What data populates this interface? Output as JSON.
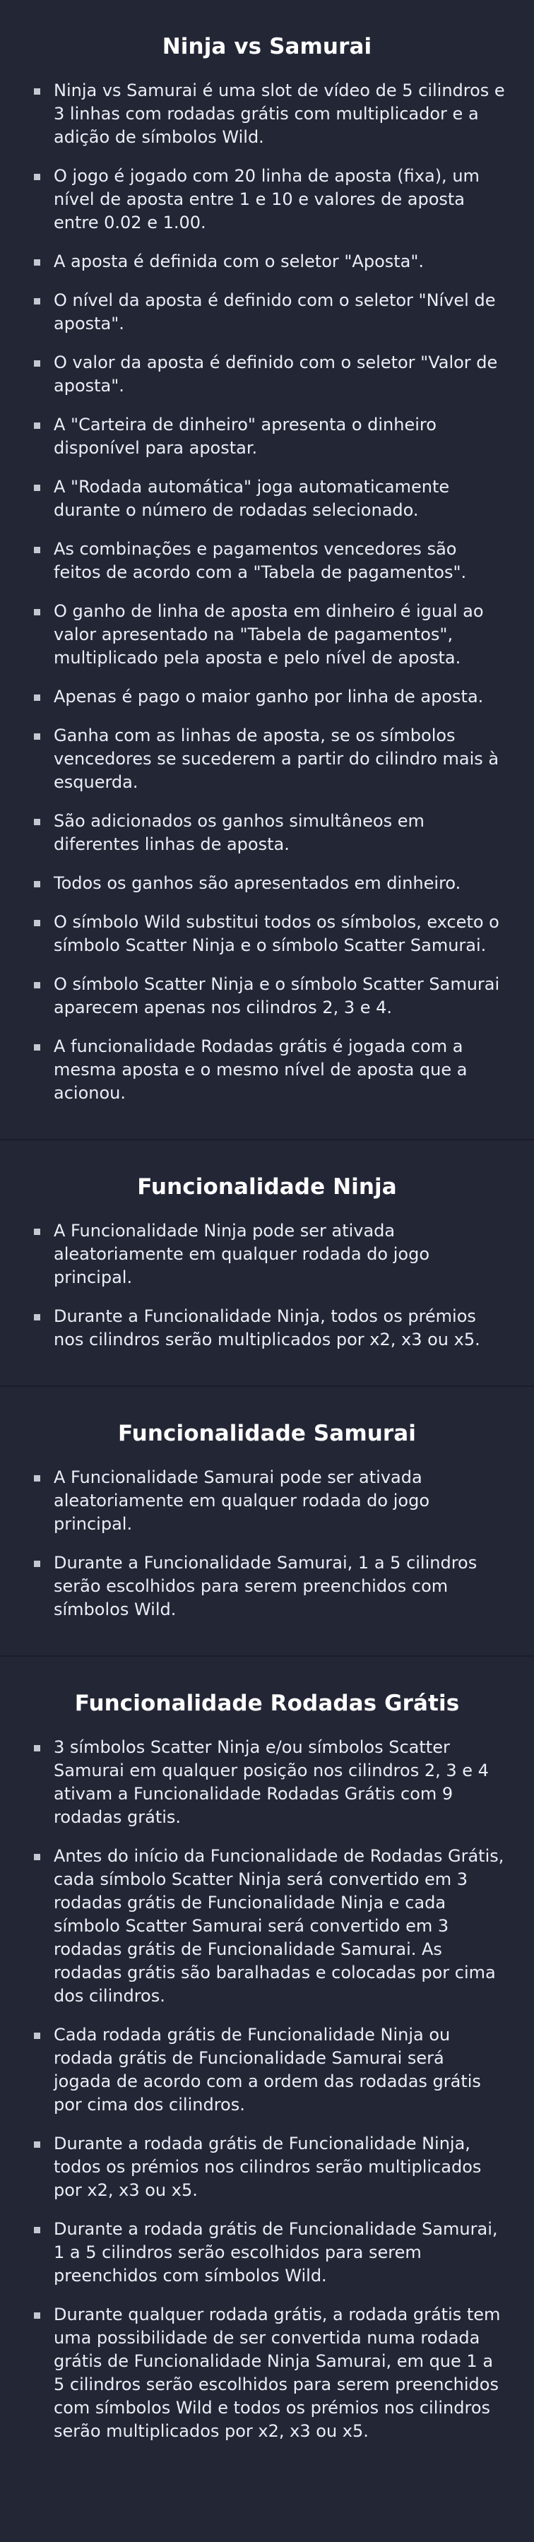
{
  "sections": [
    {
      "title": "Ninja vs Samurai",
      "items": [
        "Ninja vs Samurai é uma slot de vídeo de 5 cilindros e 3 linhas com rodadas grátis com multiplicador e a adição de símbolos Wild.",
        "O jogo é jogado com 20 linha de aposta (fixa), um nível de aposta entre 1 e 10 e valores de aposta entre 0.02 e 1.00.",
        "A aposta é definida com o seletor \"Aposta\".",
        "O nível da aposta é definido com o seletor \"Nível de aposta\".",
        "O valor da aposta é definido com o seletor \"Valor de aposta\".",
        "A \"Carteira de dinheiro\" apresenta o dinheiro disponível para apostar.",
        "A \"Rodada automática\" joga automaticamente durante o número de rodadas selecionado.",
        "As combinações e pagamentos vencedores são feitos de acordo com a \"Tabela de pagamentos\".",
        "O ganho de linha de aposta em dinheiro é igual ao valor apresentado na \"Tabela de pagamentos\", multiplicado pela aposta e pelo nível de aposta.",
        "Apenas é pago o maior ganho por linha de aposta.",
        "Ganha com as linhas de aposta, se os símbolos vencedores se sucederem a partir do cilindro mais à esquerda.",
        "São adicionados os ganhos simultâneos em diferentes linhas de aposta.",
        "Todos os ganhos são apresentados em dinheiro.",
        "O símbolo Wild substitui todos os símbolos, exceto o símbolo Scatter Ninja e o símbolo Scatter Samurai.",
        "O símbolo Scatter Ninja e o símbolo Scatter Samurai aparecem apenas nos cilindros 2, 3 e 4.",
        "A funcionalidade Rodadas grátis é jogada com a mesma aposta e o mesmo nível de aposta que a acionou."
      ]
    },
    {
      "title": "Funcionalidade Ninja",
      "items": [
        "A Funcionalidade Ninja pode ser ativada aleatoriamente em qualquer rodada do jogo principal.",
        "Durante a Funcionalidade Ninja, todos os prémios nos cilindros serão multiplicados por x2, x3 ou x5."
      ]
    },
    {
      "title": "Funcionalidade Samurai",
      "items": [
        "A Funcionalidade Samurai pode ser ativada aleatoriamente em qualquer rodada do jogo principal.",
        "Durante a Funcionalidade Samurai, 1 a 5 cilindros serão escolhidos para serem preenchidos com símbolos Wild."
      ]
    },
    {
      "title": "Funcionalidade Rodadas Grátis",
      "items": [
        "3 símbolos Scatter Ninja e/ou símbolos Scatter Samurai em qualquer posição nos cilindros 2, 3 e 4 ativam a Funcionalidade Rodadas Grátis com 9 rodadas grátis.",
        "Antes do início da Funcionalidade de Rodadas Grátis, cada símbolo Scatter Ninja será convertido em 3 rodadas grátis de Funcionalidade Ninja e cada símbolo Scatter Samurai será convertido em 3 rodadas grátis de Funcionalidade Samurai. As rodadas grátis são baralhadas e colocadas por cima dos cilindros.",
        "Cada rodada grátis de Funcionalidade Ninja ou rodada grátis de Funcionalidade Samurai será jogada de acordo com a ordem das rodadas grátis por cima dos cilindros.",
        "Durante a rodada grátis de Funcionalidade Ninja, todos os prémios nos cilindros serão multiplicados por x2, x3 ou x5.",
        "Durante a rodada grátis de Funcionalidade Samurai, 1 a 5 cilindros serão escolhidos para serem preenchidos com símbolos Wild.",
        "Durante qualquer rodada grátis, a rodada grátis tem uma possibilidade de ser convertida numa rodada grátis de Funcionalidade Ninja Samurai, em que 1 a 5 cilindros serão escolhidos para serem preenchidos com símbolos Wild e todos os prémios nos cilindros serão multiplicados por x2, x3 ou x5."
      ]
    }
  ]
}
